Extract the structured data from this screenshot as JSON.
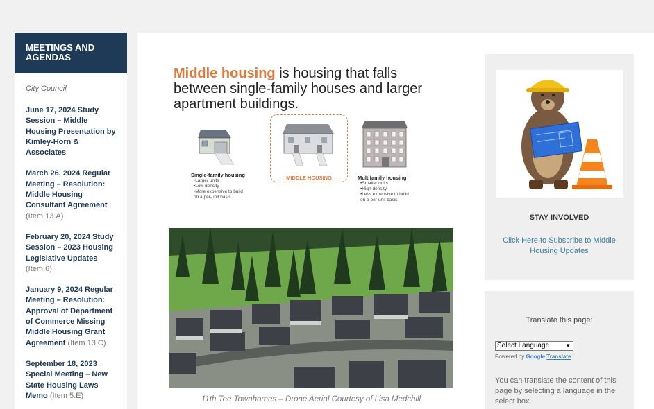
{
  "sidebar": {
    "title": "MEETINGS AND AGENDAS",
    "subtitle": "City Council",
    "meetings": [
      {
        "title": "June 17, 2024 Study Session – Middle Housing Presentation by Kimley-Horn & Associates",
        "item": ""
      },
      {
        "title": "March 26, 2024 Regular Meeting – Resolution: Middle Housing Consultant Agreement",
        "item": "(Item 13.A)"
      },
      {
        "title": "February 20, 2024 Study Session – 2023 Housing Legislative Updates",
        "item": "(Item 6)"
      },
      {
        "title": "January 9, 2024 Regular Meeting – Resolution: Approval of Department of Commerce Missing Middle Housing Grant Agreement",
        "item": "(Item 13.C)"
      },
      {
        "title": "September 18, 2023 Special Meeting – New State Housing Laws Memo",
        "item": "(Item 5.E)"
      }
    ]
  },
  "infographic": {
    "headline_accent": "Middle housing",
    "headline_rest": " is housing that falls between single-family houses and larger apartment buildings.",
    "single": {
      "label": "Single-family housing",
      "bullets": [
        "•Larger units",
        "•Low density",
        "•More expensive to build",
        "  on a per-unit basis"
      ]
    },
    "middle": {
      "label": "MIDDLE HOUSING"
    },
    "multi": {
      "label": "Multifamily housing",
      "bullets": [
        "•Smaller units",
        "•High density",
        "•Less expensive to build",
        "  on a per-unit basis"
      ]
    }
  },
  "photo": {
    "caption": "11th Tee Townhomes – Drone Aerial Courtesy of Lisa Medchill"
  },
  "stay_involved": {
    "title": "STAY INVOLVED",
    "link": "Click Here to Subscribe to Middle Housing Updates"
  },
  "translate": {
    "title": "Translate this page:",
    "select_value": "Select Language",
    "powered_by": "Powered by",
    "google": "Google",
    "translate_word": "Translate",
    "text": "You can translate the content of this page by selecting a language in the select box."
  }
}
